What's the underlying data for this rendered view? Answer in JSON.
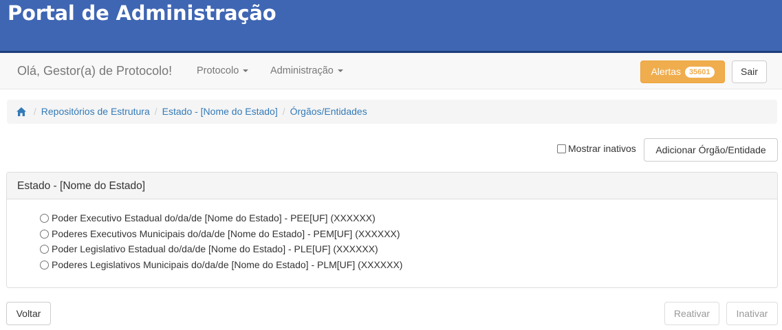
{
  "header": {
    "app_title": "Portal de Administração",
    "banner_color": "#3f66b3"
  },
  "navbar": {
    "greeting": "Olá, Gestor(a) de Protocolo!",
    "menus": [
      {
        "label": "Protocolo",
        "icon": "caret-down-icon"
      },
      {
        "label": "Administração",
        "icon": "caret-down-icon"
      }
    ],
    "alerts": {
      "label": "Alertas",
      "count": "35601",
      "color": "#f0ad4e"
    },
    "logout_label": "Sair"
  },
  "breadcrumb": {
    "home_icon": "home-icon",
    "items": [
      "Repositórios de Estrutura",
      "Estado - [Nome do Estado]",
      "Órgãos/Entidades"
    ],
    "separator": "/"
  },
  "toolbar": {
    "show_inactive_label": "Mostrar inativos",
    "show_inactive_checked": false,
    "add_button_label": "Adicionar Órgão/Entidade"
  },
  "panel": {
    "title": "Estado - [Nome do Estado]",
    "organizations": [
      "Poder Executivo Estadual do/da/de [Nome do Estado] - PEE[UF] (XXXXXX)",
      "Poderes Executivos Municipais do/da/de [Nome do Estado] - PEM[UF] (XXXXXX)",
      "Poder Legislativo Estadual do/da/de [Nome do Estado] - PLE[UF] (XXXXXX)",
      "Poderes Legislativos Municipais do/da/de [Nome do Estado] - PLM[UF] (XXXXXX)"
    ]
  },
  "footer": {
    "back_label": "Voltar",
    "reactivate_label": "Reativar",
    "inactivate_label": "Inativar"
  }
}
